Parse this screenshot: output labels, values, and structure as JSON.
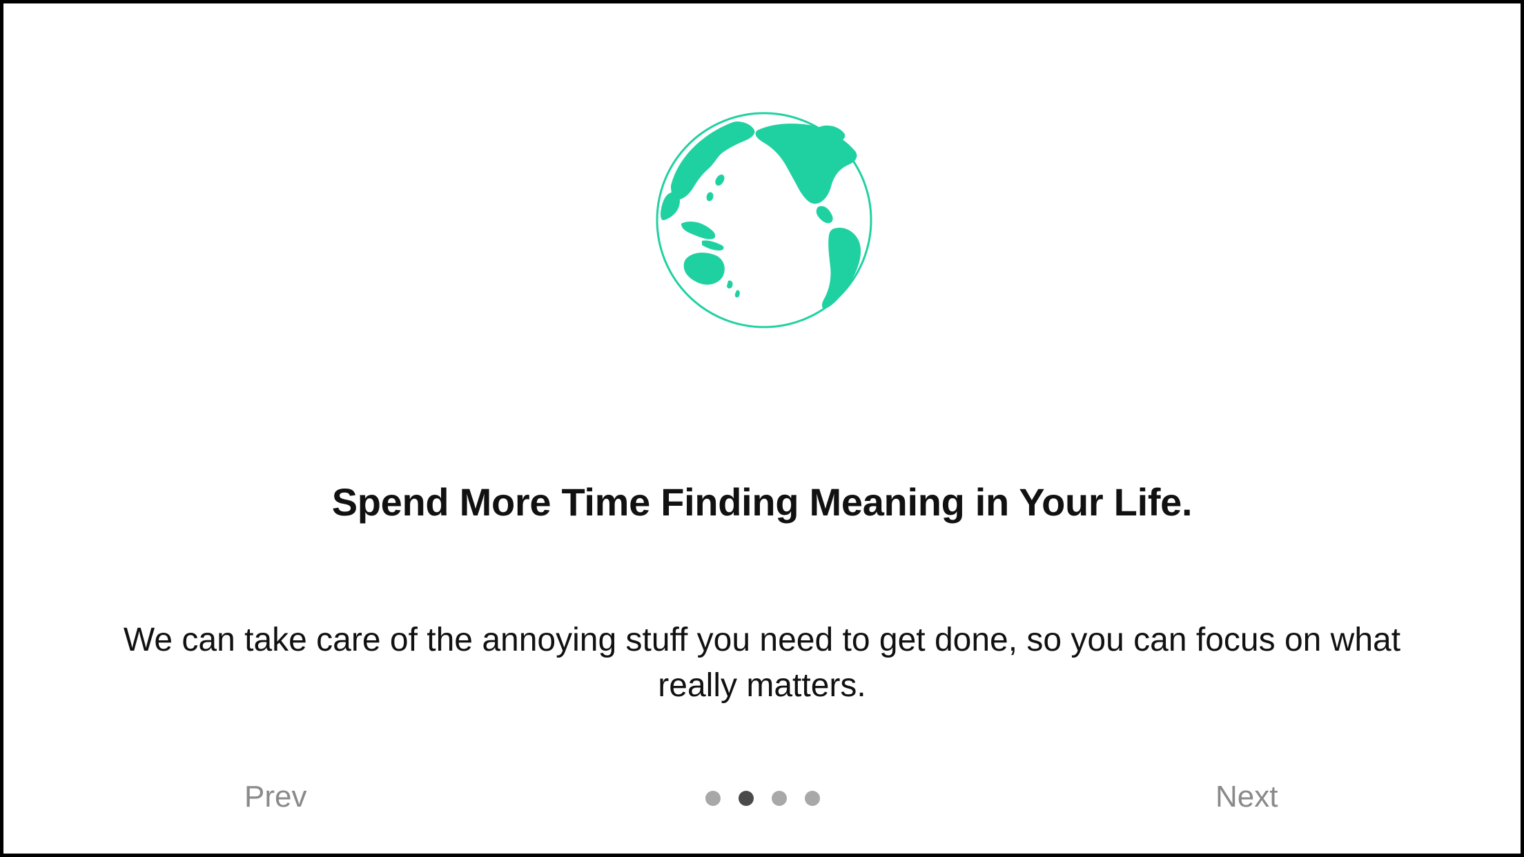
{
  "onboarding": {
    "headline": "Spend More Time Finding Meaning in Your Life.",
    "body": "We can take care of the annoying stuff you need to get done, so you can focus on what really matters.",
    "illustration_icon": "globe-icon",
    "accent_color": "#1fd1a0"
  },
  "navigation": {
    "prev_label": "Prev",
    "next_label": "Next",
    "page_count": 4,
    "current_page": 2
  }
}
